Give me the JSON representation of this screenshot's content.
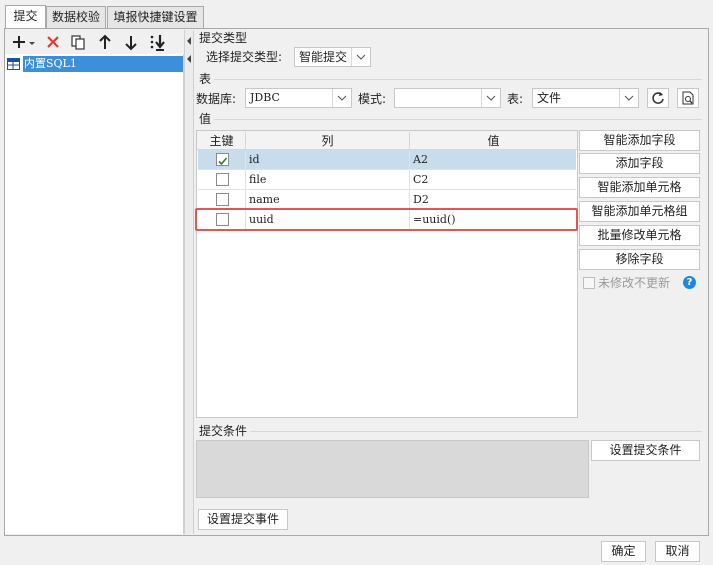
{
  "tabs": [
    {
      "label": "提交"
    },
    {
      "label": "数据校验"
    },
    {
      "label": "填报快捷键设置"
    }
  ],
  "tree": {
    "items": [
      {
        "label": "内置SQL1"
      }
    ]
  },
  "submit_type": {
    "section_label": "提交类型",
    "select_label": "选择提交类型:",
    "value": "智能提交"
  },
  "table_section": {
    "section_label": "表",
    "db_label": "数据库:",
    "db_value": "JDBC",
    "schema_label": "模式:",
    "schema_value": "",
    "table_label": "表:",
    "table_value": "文件"
  },
  "values": {
    "section_label": "值",
    "columns": [
      "主键",
      "列",
      "值"
    ],
    "rows": [
      {
        "key": true,
        "column": "id",
        "value": "A2"
      },
      {
        "key": false,
        "column": "file",
        "value": "C2"
      },
      {
        "key": false,
        "column": "name",
        "value": "D2"
      },
      {
        "key": false,
        "column": "uuid",
        "value": "=uuid()"
      }
    ],
    "buttons": {
      "smart_add_field": "智能添加字段",
      "add_field": "添加字段",
      "smart_add_cell": "智能添加单元格",
      "smart_add_cell_group": "智能添加单元格组",
      "batch_modify_cell": "批量修改单元格",
      "remove_field": "移除字段"
    },
    "no_update_unmodified": "未修改不更新"
  },
  "condition": {
    "section_label": "提交条件",
    "set_button": "设置提交条件"
  },
  "event_button": "设置提交事件",
  "footer": {
    "ok": "确定",
    "cancel": "取消"
  },
  "colors": {
    "selected_row": "#c9dceb",
    "tree_selection": "#3c8fd8",
    "highlight_border": "#e05555",
    "delete_red": "#e53935",
    "help_blue": "#1e88e5"
  }
}
